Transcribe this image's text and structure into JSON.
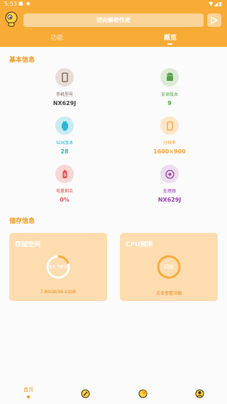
{
  "status": {
    "time": "5:53",
    "icons": "▼◢▮"
  },
  "header": {
    "search_text": "逆向解密传奇",
    "tabs": [
      {
        "label": "功能"
      },
      {
        "label": "概览"
      }
    ]
  },
  "basic_info": {
    "title": "基本信息",
    "items": [
      {
        "label": "手机型号",
        "value": "NX629J",
        "icon": "phone-icon",
        "bg": "#e9dcd6",
        "fg": "#7a5a4f",
        "value_color": "#444444",
        "label_color": "#7a5a4f"
      },
      {
        "label": "安卓版本",
        "value": "9",
        "icon": "android-icon",
        "bg": "#dcebd6",
        "fg": "#59a04d",
        "value_color": "#59a04d",
        "label_color": "#59a04d"
      },
      {
        "label": "SDK版本",
        "value": "28",
        "icon": "sdk-icon",
        "bg": "#c9ecf3",
        "fg": "#2ab6d8",
        "value_color": "#2ab6d8",
        "label_color": "#2ab6d8"
      },
      {
        "label": "分辨率",
        "value": "1600×900",
        "icon": "screen-icon",
        "bg": "#fde6c8",
        "fg": "#f3a33a",
        "value_color": "#f3a33a",
        "label_color": "#f3a33a"
      },
      {
        "label": "电量剩余",
        "value": "0%",
        "icon": "battery-icon",
        "bg": "#f9d6d6",
        "fg": "#e54d4d",
        "value_color": "#e54d4d",
        "label_color": "#e54d4d"
      },
      {
        "label": "处理器",
        "value": "NX629J",
        "icon": "cpu-icon",
        "bg": "#ecdcf0",
        "fg": "#9a3fb0",
        "value_color": "#9a3fb0",
        "label_color": "#9a3fb0"
      }
    ]
  },
  "storage": {
    "title": "储存信息",
    "cards": [
      {
        "title": "存储空间",
        "ring_text": "19.78%",
        "percent": 19.78,
        "footer": "7.80GB/39.43GB"
      },
      {
        "title": "CPU频率",
        "ring_text": "四核",
        "percent": 100,
        "footer": "点击查看详细"
      }
    ]
  },
  "bottom_nav": {
    "items": [
      {
        "label": "首页",
        "icon": "home-icon",
        "active": true
      },
      {
        "label": "",
        "icon": "tools-icon",
        "active": false
      },
      {
        "label": "",
        "icon": "stats-icon",
        "active": false
      },
      {
        "label": "",
        "icon": "profile-icon",
        "active": false
      }
    ]
  },
  "colors": {
    "accent": "#f8ab35",
    "card": "#fddcb0",
    "ring": "#f8ab35"
  }
}
